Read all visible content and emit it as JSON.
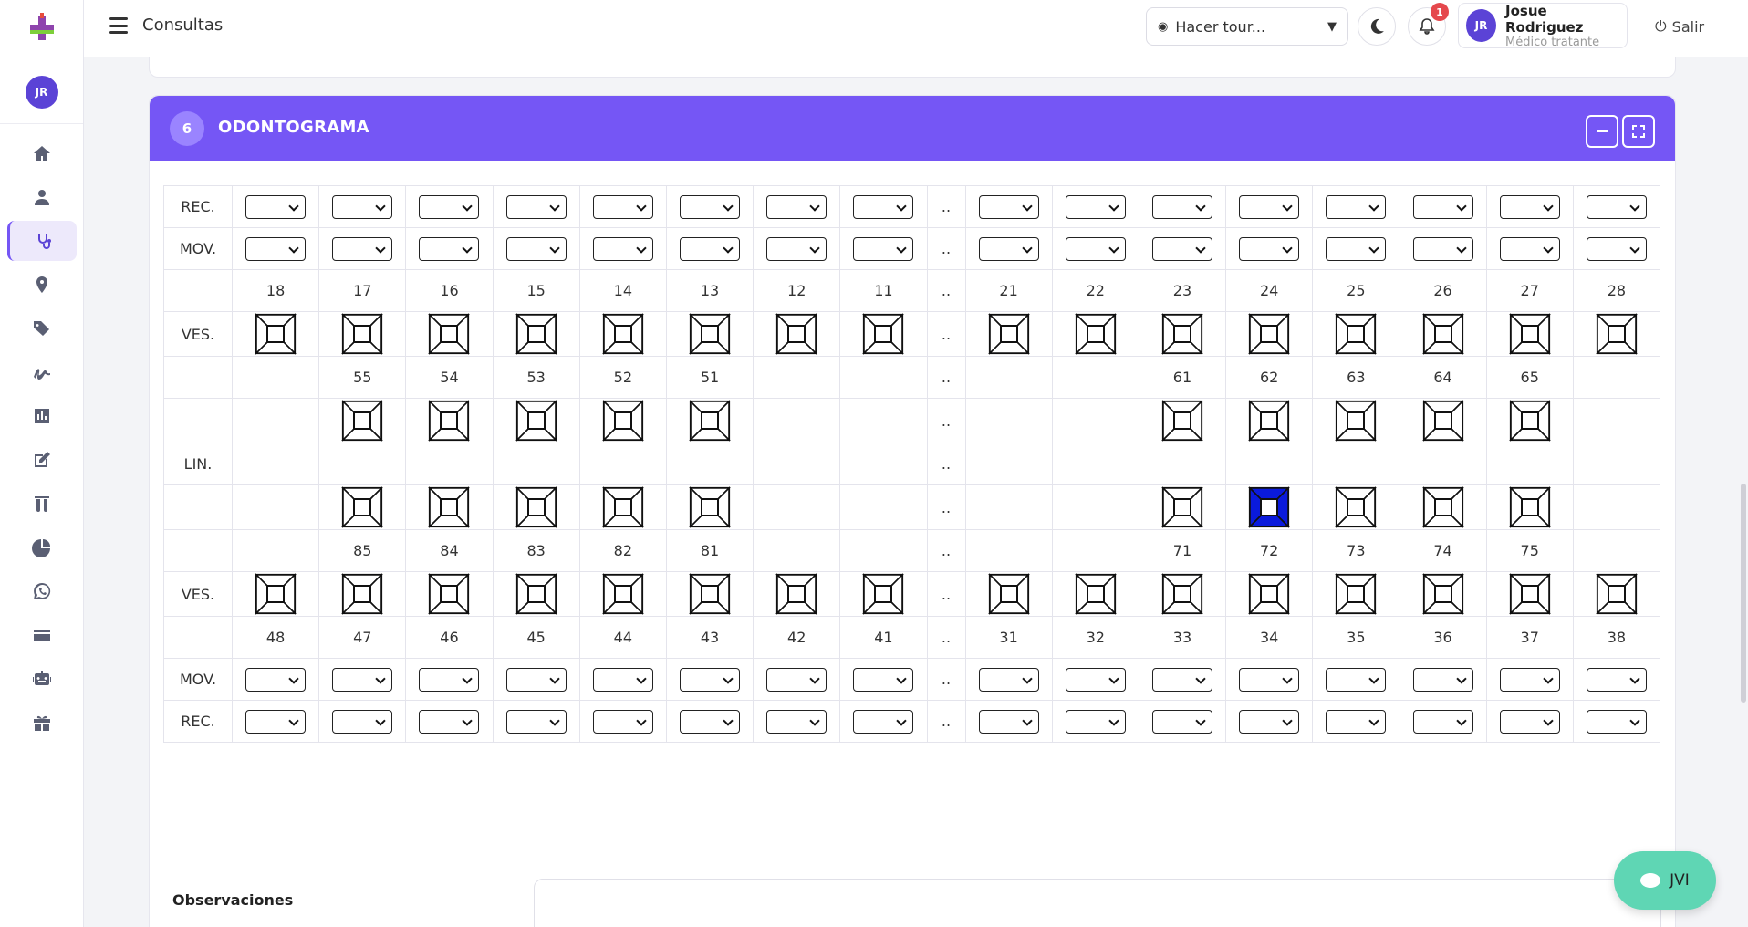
{
  "sidebar": {
    "avatar": "JR",
    "items": [
      {
        "name": "home-icon"
      },
      {
        "name": "user-icon"
      },
      {
        "name": "stethoscope-icon",
        "active": true
      },
      {
        "name": "map-marker-icon"
      },
      {
        "name": "tags-icon"
      },
      {
        "name": "signature-icon"
      },
      {
        "name": "chart-icon"
      },
      {
        "name": "edit-icon"
      },
      {
        "name": "flask-icon"
      },
      {
        "name": "pie-chart-icon"
      },
      {
        "name": "whatsapp-icon"
      },
      {
        "name": "credit-card-icon"
      },
      {
        "name": "robot-icon"
      },
      {
        "name": "gift-icon"
      }
    ]
  },
  "header": {
    "title": "Consultas",
    "tour_select": "Hacer tour...",
    "notifications_count": "1",
    "user_initials": "JR",
    "user_name": "Josue Rodriguez",
    "user_role": "Médico tratante",
    "logout": "Salir"
  },
  "section": {
    "number": "6",
    "title": "ODONTOGRAMA"
  },
  "odontogram": {
    "separator": "..",
    "labels": {
      "rec": "REC.",
      "mov": "MOV.",
      "ves": "VES.",
      "lin": "LIN."
    },
    "upper_permanent": [
      "18",
      "17",
      "16",
      "15",
      "14",
      "13",
      "12",
      "11",
      "21",
      "22",
      "23",
      "24",
      "25",
      "26",
      "27",
      "28"
    ],
    "upper_deciduous": [
      "",
      "55",
      "54",
      "53",
      "52",
      "51",
      "",
      "",
      "",
      "",
      "61",
      "62",
      "63",
      "64",
      "65",
      ""
    ],
    "lower_deciduous": [
      "",
      "85",
      "84",
      "83",
      "82",
      "81",
      "",
      "",
      "",
      "",
      "71",
      "72",
      "73",
      "74",
      "75",
      ""
    ],
    "lower_permanent": [
      "48",
      "47",
      "46",
      "45",
      "44",
      "43",
      "42",
      "41",
      "31",
      "32",
      "33",
      "34",
      "35",
      "36",
      "37",
      "38"
    ],
    "selected_tooth": "72",
    "selected_color": "#0a1adc"
  },
  "observations": {
    "label": "Observaciones"
  },
  "chat": {
    "label": "JVI"
  }
}
